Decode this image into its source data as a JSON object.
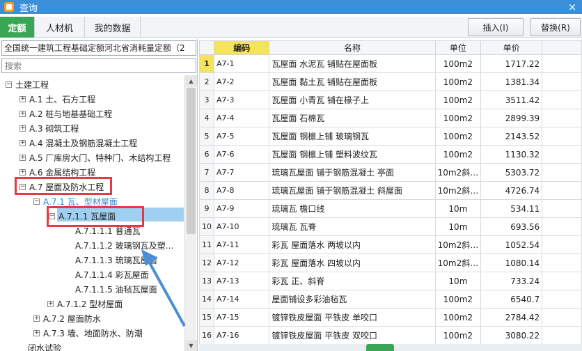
{
  "window": {
    "title": "查询",
    "close_label": "×"
  },
  "tabs": [
    {
      "label": "定额",
      "active": true
    },
    {
      "label": "人材机",
      "active": false
    },
    {
      "label": "我的数据",
      "active": false
    }
  ],
  "toolbar": {
    "insert_label": "插入(I)",
    "replace_label": "替换(R)"
  },
  "left": {
    "quota_library": "全国统一建筑工程基础定额河北省消耗量定额（2",
    "search_placeholder": "搜索"
  },
  "tree": [
    {
      "label": "土建工程",
      "expander": "−"
    },
    {
      "label": "A.1 土、石方工程",
      "expander": "+"
    },
    {
      "label": "A.2 桩与地基基础工程",
      "expander": "+"
    },
    {
      "label": "A.3 砌筑工程",
      "expander": "+"
    },
    {
      "label": "A.4 混凝土及钢筋混凝土工程",
      "expander": "+"
    },
    {
      "label": "A.5 厂库房大门、特种门、木结构工程",
      "expander": "+"
    },
    {
      "label": "A.6 金属结构工程",
      "expander": "+"
    },
    {
      "label": "A.7 屋面及防水工程",
      "expander": "−"
    },
    {
      "label": "A.7.1 瓦、型材屋面",
      "expander": "−"
    },
    {
      "label": "A.7.1.1 瓦屋面",
      "expander": "−"
    },
    {
      "label": "A.7.1.1.1 普通瓦",
      "expander": ""
    },
    {
      "label": "A.7.1.1.2 玻璃钢瓦及塑…",
      "expander": ""
    },
    {
      "label": "A.7.1.1.3 琉璃瓦屋面",
      "expander": ""
    },
    {
      "label": "A.7.1.1.4 彩瓦屋面",
      "expander": ""
    },
    {
      "label": "A.7.1.1.5 油毡瓦屋面",
      "expander": ""
    },
    {
      "label": "A.7.1.2 型材屋面",
      "expander": "+"
    },
    {
      "label": "A.7.2 屋面防水",
      "expander": "+"
    },
    {
      "label": "A.7.3 墙、地面防水、防潮",
      "expander": "+"
    },
    {
      "label": "闭水试验",
      "expander": ""
    }
  ],
  "grid": {
    "headers": {
      "code": "编码",
      "name": "名称",
      "unit": "单位",
      "price": "单价"
    },
    "rows": [
      {
        "n": "1",
        "code": "A7-1",
        "name": "瓦屋面 水泥瓦 铺贴在屋面板",
        "unit": "100m2",
        "price": "1717.22"
      },
      {
        "n": "2",
        "code": "A7-2",
        "name": "瓦屋面 黏土瓦 铺贴在屋面板",
        "unit": "100m2",
        "price": "1381.34"
      },
      {
        "n": "3",
        "code": "A7-3",
        "name": "瓦屋面 小青瓦 铺在椽子上",
        "unit": "100m2",
        "price": "3511.42"
      },
      {
        "n": "4",
        "code": "A7-4",
        "name": "瓦屋面 石棉瓦",
        "unit": "100m2",
        "price": "2899.39"
      },
      {
        "n": "5",
        "code": "A7-5",
        "name": "瓦屋面 钢檩上铺 玻璃钢瓦",
        "unit": "100m2",
        "price": "2143.52"
      },
      {
        "n": "6",
        "code": "A7-6",
        "name": "瓦屋面 钢檩上铺 塑料波纹瓦",
        "unit": "100m2",
        "price": "1130.32"
      },
      {
        "n": "7",
        "code": "A7-7",
        "name": "琉璃瓦屋面 铺于钢筋混凝土 亭面",
        "unit": "10m2斜…",
        "price": "5303.72"
      },
      {
        "n": "8",
        "code": "A7-8",
        "name": "琉璃瓦屋面 铺于钢筋混凝土 斜屋面",
        "unit": "10m2斜…",
        "price": "4726.74"
      },
      {
        "n": "9",
        "code": "A7-9",
        "name": "琉璃瓦 檐口线",
        "unit": "10m",
        "price": "534.11"
      },
      {
        "n": "10",
        "code": "A7-10",
        "name": "琉璃瓦 瓦脊",
        "unit": "10m",
        "price": "693.56"
      },
      {
        "n": "11",
        "code": "A7-11",
        "name": "彩瓦 屋面落水 两坡以内",
        "unit": "10m2斜…",
        "price": "1052.54"
      },
      {
        "n": "12",
        "code": "A7-12",
        "name": "彩瓦 屋面落水 四坡以内",
        "unit": "10m2斜…",
        "price": "1080.14"
      },
      {
        "n": "13",
        "code": "A7-13",
        "name": "彩瓦 正、斜脊",
        "unit": "10m",
        "price": "733.24"
      },
      {
        "n": "14",
        "code": "A7-14",
        "name": "屋面铺设多彩油毡瓦",
        "unit": "100m2",
        "price": "6540.7"
      },
      {
        "n": "15",
        "code": "A7-15",
        "name": "镀锌铁皮屋面 平铁皮 单咬口",
        "unit": "100m2",
        "price": "2784.42"
      },
      {
        "n": "16",
        "code": "A7-16",
        "name": "镀锌铁皮屋面 平铁皮 双咬口",
        "unit": "100m2",
        "price": "3080.22"
      }
    ]
  },
  "icons": {
    "expander": "plus-minus-box-icon",
    "scroll_up": "up-arrow-icon",
    "scroll_down": "down-arrow-icon"
  },
  "colors": {
    "titlebar": "#3b8fd9",
    "active_tab": "#3aa655",
    "highlight_box": "#e63946",
    "header_highlight": "#f4e45c",
    "tree_link": "#2e86d4",
    "selection": "#9fd0f2"
  }
}
